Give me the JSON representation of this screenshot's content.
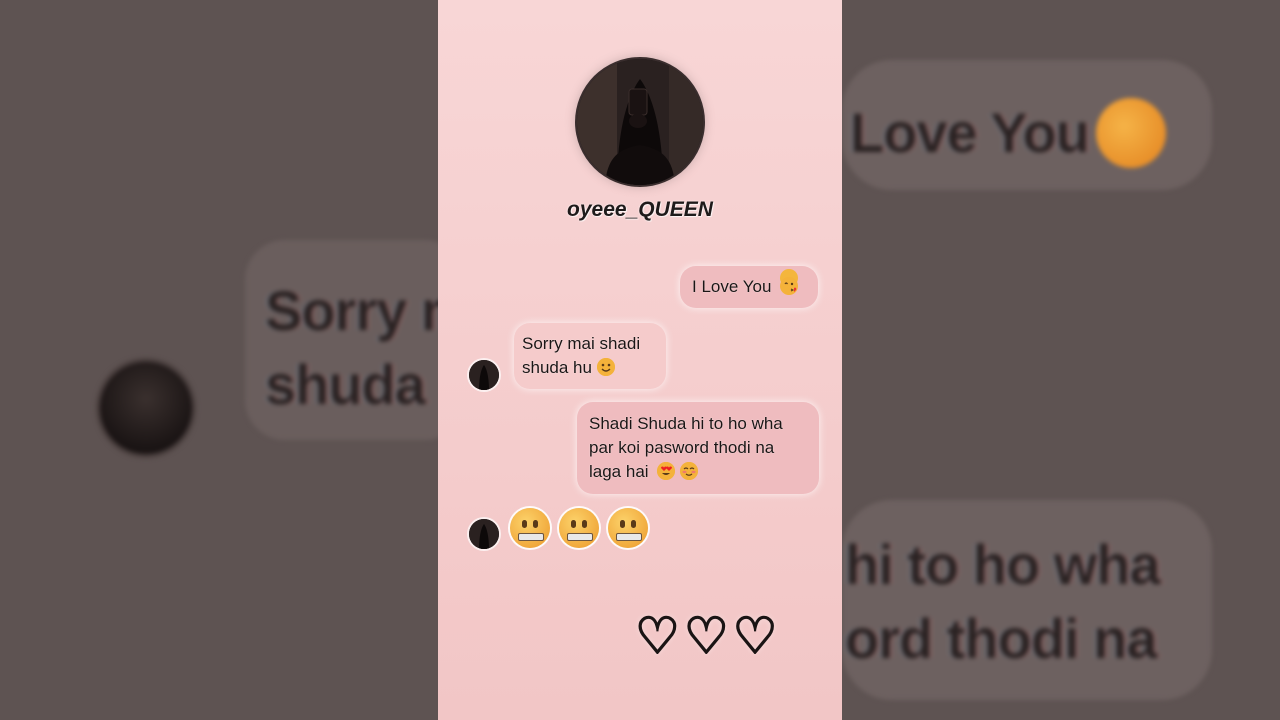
{
  "background": {
    "echo_top_right": "Love You",
    "echo_left_line1": "Sorry m",
    "echo_left_line2": "shuda",
    "echo_bottom_right_line1": "hi to ho wha",
    "echo_bottom_right_line2": "ord thodi na"
  },
  "profile": {
    "username": "oyeee_QUEEN",
    "avatar_icon": "profile-photo"
  },
  "messages": [
    {
      "direction": "outgoing",
      "text": "I Love You",
      "emoji": "kissing-face"
    },
    {
      "direction": "incoming",
      "line1": "Sorry mai shadi",
      "line2": "shuda hu",
      "emoji": "smiling-face"
    },
    {
      "direction": "outgoing",
      "line1": "Shadi Shuda hi to ho wha",
      "line2": "par koi pasword thodi na",
      "line3": "laga hai",
      "emoji": "heart-eyes, blush"
    },
    {
      "direction": "incoming",
      "emoji_only": "zipper-mouth x3"
    }
  ],
  "hearts": "♡♡♡",
  "colors": {
    "panel": "#f4cfcf",
    "bubble_outgoing": "#efbcbf",
    "bubble_incoming": "#f5cbcb",
    "backdrop": "#5e5352"
  }
}
